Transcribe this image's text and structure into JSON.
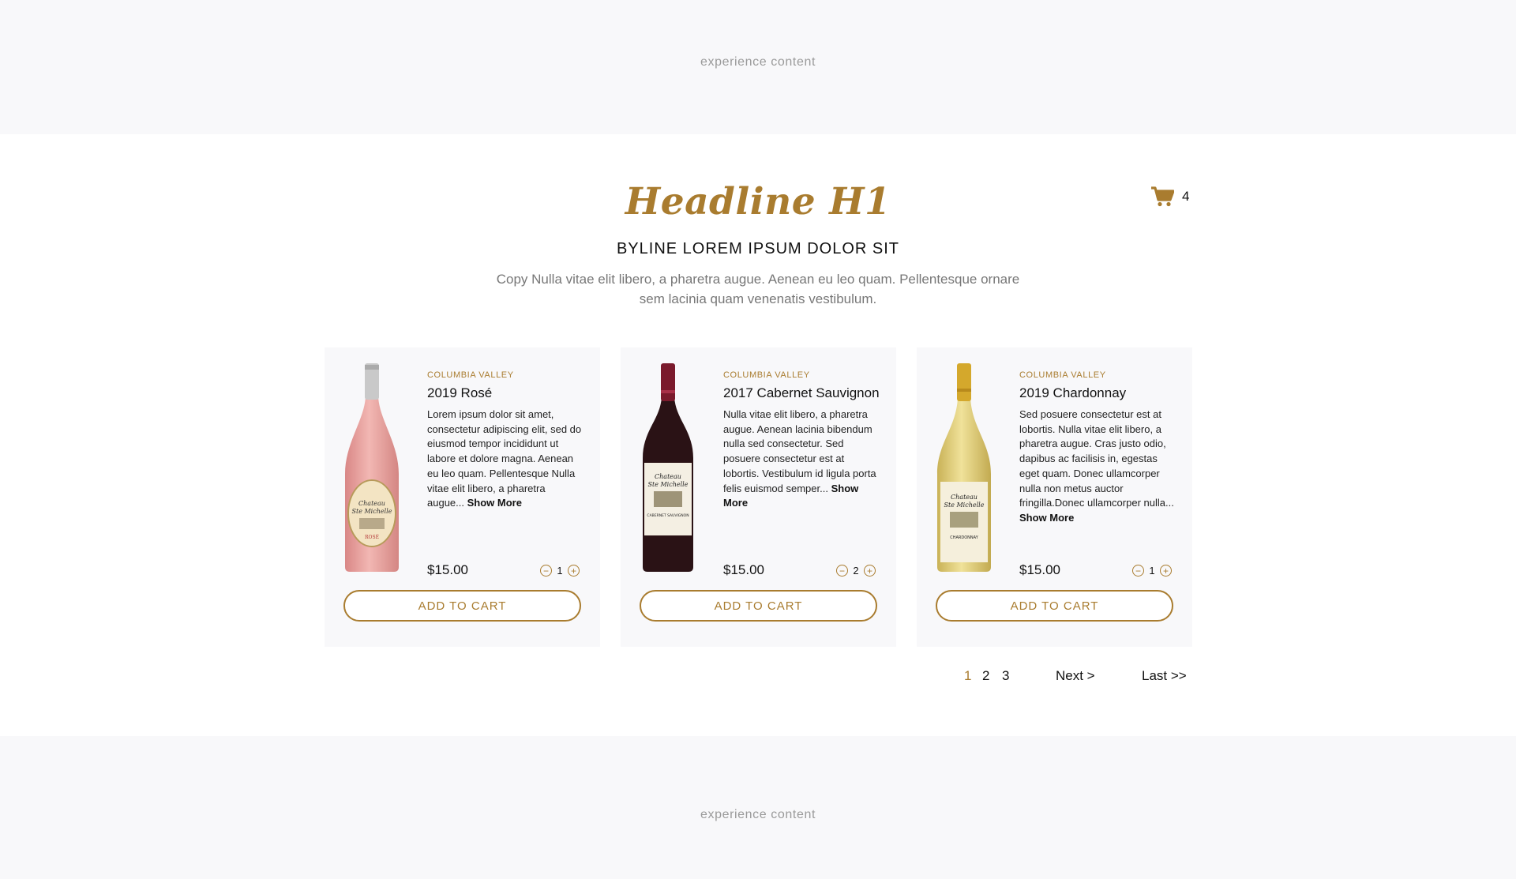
{
  "experience_top": {
    "text": "experience content"
  },
  "experience_bottom": {
    "text": "experience content"
  },
  "header": {
    "headline": "Headline H1",
    "byline": "BYLINE LOREM IPSUM DOLOR SIT",
    "copy": "Copy Nulla vitae elit libero, a pharetra augue. Aenean eu leo quam. Pellentesque ornare sem lacinia quam venenatis vestibulum."
  },
  "cart": {
    "icon": "shopping-cart-icon",
    "count": "4"
  },
  "products": [
    {
      "region": "COLUMBIA VALLEY",
      "title": "2019 Rosé",
      "description": "Lorem ipsum dolor sit amet, consectetur adipiscing elit, sed do eiusmod tempor incididunt ut labore et dolore magna. Aenean eu leo quam. Pellentesque Nulla vitae elit libero, a pharetra augue...",
      "show_more": "Show More",
      "price": "$15.00",
      "quantity": "1",
      "add_to_cart": "ADD TO CART",
      "bottle_color": "#e8a3a0",
      "label_text": "Rosé"
    },
    {
      "region": "COLUMBIA VALLEY",
      "title": "2017 Cabernet Sauvignon",
      "description": "Nulla vitae elit libero, a pharetra augue. Aenean lacinia bibendum nulla sed consectetur. Sed posuere consectetur est at lobortis. Vestibulum id ligula porta felis euismod semper...",
      "show_more": "Show More",
      "price": "$15.00",
      "quantity": "2",
      "add_to_cart": "ADD TO CART",
      "bottle_color": "#2a1215",
      "label_text": "Cabernet Sauvignon"
    },
    {
      "region": "COLUMBIA VALLEY",
      "title": "2019 Chardonnay",
      "description": "Sed posuere consectetur est at lobortis. Nulla vitae elit libero, a pharetra augue. Cras justo odio, dapibus ac facilisis in, egestas eget quam. Donec ullamcorper nulla non metus auctor fringilla.Donec ullamcorper nulla...",
      "show_more": "Show More",
      "price": "$15.00",
      "quantity": "1",
      "add_to_cart": "ADD TO CART",
      "bottle_color": "#e3cf7a",
      "label_text": "Chardonnay"
    }
  ],
  "pagination": {
    "pages": [
      "1",
      "2",
      "3"
    ],
    "active_page": "1",
    "next": "Next >",
    "last": "Last >>"
  },
  "colors": {
    "accent": "#a97c2f",
    "panel_bg": "#f8f8fa"
  }
}
